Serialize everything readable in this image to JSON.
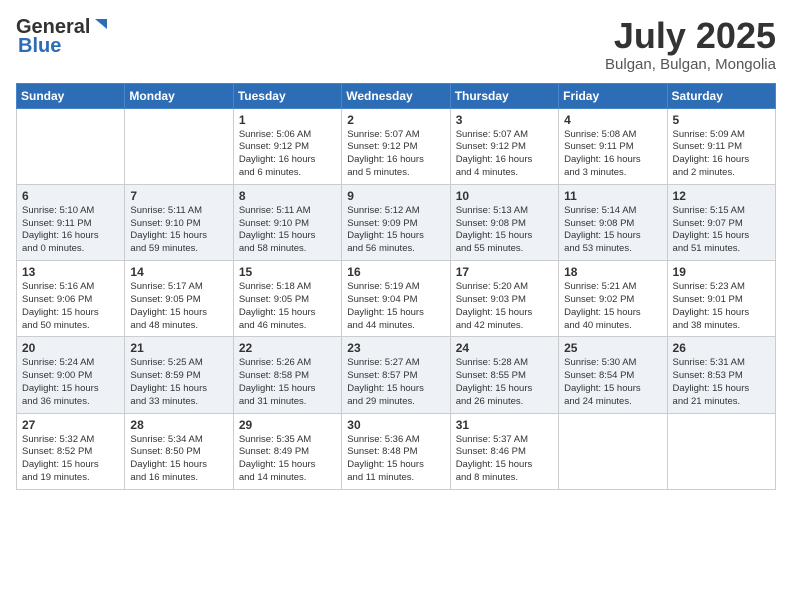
{
  "header": {
    "logo_general": "General",
    "logo_blue": "Blue",
    "month_title": "July 2025",
    "location": "Bulgan, Bulgan, Mongolia"
  },
  "weekdays": [
    "Sunday",
    "Monday",
    "Tuesday",
    "Wednesday",
    "Thursday",
    "Friday",
    "Saturday"
  ],
  "weeks": [
    [
      {
        "day": "",
        "info": ""
      },
      {
        "day": "",
        "info": ""
      },
      {
        "day": "1",
        "info": "Sunrise: 5:06 AM\nSunset: 9:12 PM\nDaylight: 16 hours\nand 6 minutes."
      },
      {
        "day": "2",
        "info": "Sunrise: 5:07 AM\nSunset: 9:12 PM\nDaylight: 16 hours\nand 5 minutes."
      },
      {
        "day": "3",
        "info": "Sunrise: 5:07 AM\nSunset: 9:12 PM\nDaylight: 16 hours\nand 4 minutes."
      },
      {
        "day": "4",
        "info": "Sunrise: 5:08 AM\nSunset: 9:11 PM\nDaylight: 16 hours\nand 3 minutes."
      },
      {
        "day": "5",
        "info": "Sunrise: 5:09 AM\nSunset: 9:11 PM\nDaylight: 16 hours\nand 2 minutes."
      }
    ],
    [
      {
        "day": "6",
        "info": "Sunrise: 5:10 AM\nSunset: 9:11 PM\nDaylight: 16 hours\nand 0 minutes."
      },
      {
        "day": "7",
        "info": "Sunrise: 5:11 AM\nSunset: 9:10 PM\nDaylight: 15 hours\nand 59 minutes."
      },
      {
        "day": "8",
        "info": "Sunrise: 5:11 AM\nSunset: 9:10 PM\nDaylight: 15 hours\nand 58 minutes."
      },
      {
        "day": "9",
        "info": "Sunrise: 5:12 AM\nSunset: 9:09 PM\nDaylight: 15 hours\nand 56 minutes."
      },
      {
        "day": "10",
        "info": "Sunrise: 5:13 AM\nSunset: 9:08 PM\nDaylight: 15 hours\nand 55 minutes."
      },
      {
        "day": "11",
        "info": "Sunrise: 5:14 AM\nSunset: 9:08 PM\nDaylight: 15 hours\nand 53 minutes."
      },
      {
        "day": "12",
        "info": "Sunrise: 5:15 AM\nSunset: 9:07 PM\nDaylight: 15 hours\nand 51 minutes."
      }
    ],
    [
      {
        "day": "13",
        "info": "Sunrise: 5:16 AM\nSunset: 9:06 PM\nDaylight: 15 hours\nand 50 minutes."
      },
      {
        "day": "14",
        "info": "Sunrise: 5:17 AM\nSunset: 9:05 PM\nDaylight: 15 hours\nand 48 minutes."
      },
      {
        "day": "15",
        "info": "Sunrise: 5:18 AM\nSunset: 9:05 PM\nDaylight: 15 hours\nand 46 minutes."
      },
      {
        "day": "16",
        "info": "Sunrise: 5:19 AM\nSunset: 9:04 PM\nDaylight: 15 hours\nand 44 minutes."
      },
      {
        "day": "17",
        "info": "Sunrise: 5:20 AM\nSunset: 9:03 PM\nDaylight: 15 hours\nand 42 minutes."
      },
      {
        "day": "18",
        "info": "Sunrise: 5:21 AM\nSunset: 9:02 PM\nDaylight: 15 hours\nand 40 minutes."
      },
      {
        "day": "19",
        "info": "Sunrise: 5:23 AM\nSunset: 9:01 PM\nDaylight: 15 hours\nand 38 minutes."
      }
    ],
    [
      {
        "day": "20",
        "info": "Sunrise: 5:24 AM\nSunset: 9:00 PM\nDaylight: 15 hours\nand 36 minutes."
      },
      {
        "day": "21",
        "info": "Sunrise: 5:25 AM\nSunset: 8:59 PM\nDaylight: 15 hours\nand 33 minutes."
      },
      {
        "day": "22",
        "info": "Sunrise: 5:26 AM\nSunset: 8:58 PM\nDaylight: 15 hours\nand 31 minutes."
      },
      {
        "day": "23",
        "info": "Sunrise: 5:27 AM\nSunset: 8:57 PM\nDaylight: 15 hours\nand 29 minutes."
      },
      {
        "day": "24",
        "info": "Sunrise: 5:28 AM\nSunset: 8:55 PM\nDaylight: 15 hours\nand 26 minutes."
      },
      {
        "day": "25",
        "info": "Sunrise: 5:30 AM\nSunset: 8:54 PM\nDaylight: 15 hours\nand 24 minutes."
      },
      {
        "day": "26",
        "info": "Sunrise: 5:31 AM\nSunset: 8:53 PM\nDaylight: 15 hours\nand 21 minutes."
      }
    ],
    [
      {
        "day": "27",
        "info": "Sunrise: 5:32 AM\nSunset: 8:52 PM\nDaylight: 15 hours\nand 19 minutes."
      },
      {
        "day": "28",
        "info": "Sunrise: 5:34 AM\nSunset: 8:50 PM\nDaylight: 15 hours\nand 16 minutes."
      },
      {
        "day": "29",
        "info": "Sunrise: 5:35 AM\nSunset: 8:49 PM\nDaylight: 15 hours\nand 14 minutes."
      },
      {
        "day": "30",
        "info": "Sunrise: 5:36 AM\nSunset: 8:48 PM\nDaylight: 15 hours\nand 11 minutes."
      },
      {
        "day": "31",
        "info": "Sunrise: 5:37 AM\nSunset: 8:46 PM\nDaylight: 15 hours\nand 8 minutes."
      },
      {
        "day": "",
        "info": ""
      },
      {
        "day": "",
        "info": ""
      }
    ]
  ]
}
